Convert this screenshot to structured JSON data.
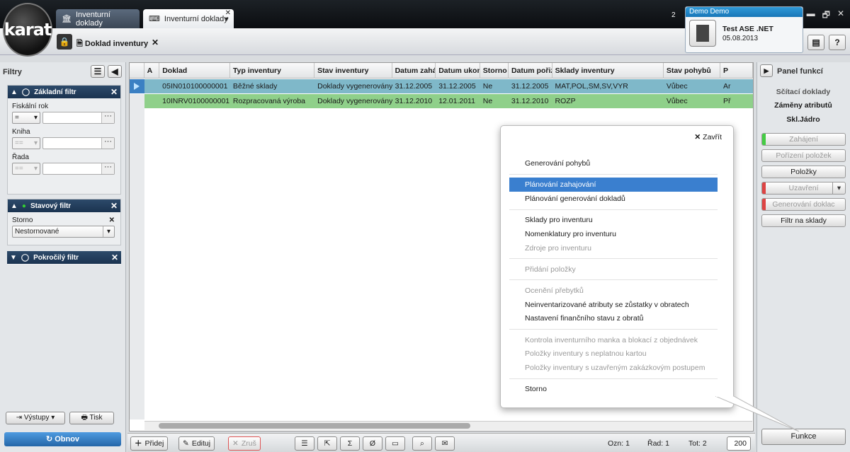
{
  "app": {
    "logo_text": "karat"
  },
  "tabs": [
    {
      "label": "Inventurní doklady"
    },
    {
      "label": "Inventurní doklady",
      "close": "✕",
      "more": "▾"
    }
  ],
  "tab_counter": "2",
  "user": {
    "header": "Demo Demo",
    "company": "Test ASE .NET",
    "date": "05.08.2013"
  },
  "window_controls": [
    "▬",
    "🗗",
    "✕"
  ],
  "toolbar": {
    "doc_title": "Doklad inventury",
    "close": "✕",
    "help": "?"
  },
  "left": {
    "title": "Filtry",
    "basic": {
      "title": "Základní filtr",
      "fiscal_label": "Fiskální rok",
      "fiscal_op": "=",
      "book_label": "Kniha",
      "book_op": "==",
      "series_label": "Řada",
      "series_op": "=="
    },
    "status": {
      "title": "Stavový filtr",
      "storno_label": "Storno",
      "storno_value": "Nestornované"
    },
    "advanced": {
      "title": "Pokročilý filtr"
    },
    "outputs": "Výstupy",
    "print": "Tisk",
    "refresh": "Obnov"
  },
  "grid": {
    "columns": [
      "A",
      "Doklad",
      "Typ inventury",
      "Stav inventury",
      "Datum zaháj",
      "Datum ukon",
      "Storno",
      "Datum pořiz",
      "Sklady inventury",
      "Stav pohybů",
      "P"
    ],
    "rows": [
      [
        "",
        "05IN010100000001",
        "Běžné sklady",
        "Doklady vygenerovány",
        "31.12.2005",
        "31.12.2005",
        "Ne",
        "31.12.2005",
        "MAT,POL,SM,SV,VYR",
        "Vůbec",
        "Ar"
      ],
      [
        "",
        "10INRV0100000001",
        "Rozpracovaná výroba",
        "Doklady vygenerovány",
        "31.12.2010",
        "12.01.2011",
        "Ne",
        "31.12.2010",
        "ROZP",
        "Vůbec",
        "Př"
      ]
    ]
  },
  "bottom": {
    "add": "Přidej",
    "edit": "Edituj",
    "cancel": "Zruš",
    "ozn": "Ozn: 1",
    "rad": "Řad: 1",
    "tot": "Tot: 2",
    "pagesize": "200"
  },
  "right": {
    "title": "Panel funkcí",
    "texts": [
      "Sčítací doklady",
      "Záměny atributů",
      "Skl.Jádro"
    ],
    "buttons": [
      "Zahájení",
      "Pořízení položek",
      "Položky",
      "Uzavření",
      "Generování doklac",
      "Filtr na sklady"
    ],
    "funkce": "Funkce"
  },
  "popup": {
    "close": "Zavřít",
    "items": [
      "Generování pohybů",
      "Plánování zahajování",
      "Plánování generování dokladů",
      "Sklady pro inventuru",
      "Nomenklatury pro inventuru",
      "Zdroje pro inventuru",
      "Přidání položky",
      "Ocenění přebytků",
      "Neinventarizované atributy se zůstatky v obratech",
      "Nastavení finančního stavu z obratů",
      "Kontrola inventurního manka a blokací z objednávek",
      "Položky inventury s neplatnou kartou",
      "Položky inventury s uzavřeným zakázkovým postupem",
      "Storno"
    ]
  },
  "colors": {
    "row1": "#7fb8c9",
    "row2": "#8fd08a",
    "accent": "#3a7fcf",
    "header_dark": "#1b3350"
  }
}
